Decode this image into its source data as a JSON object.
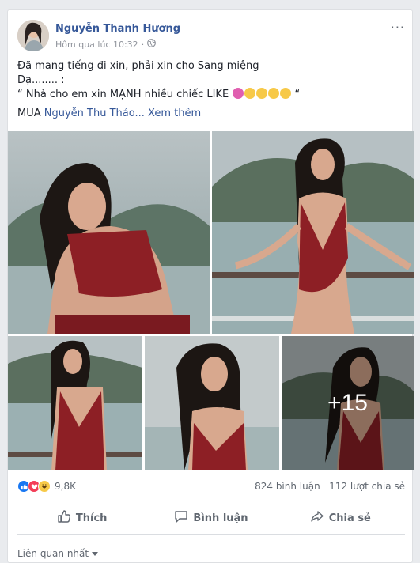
{
  "post": {
    "author": "Nguyễn Thanh Hương",
    "time": "Hôm qua lúc 10:32",
    "privacy_icon": "globe-icon",
    "more_label": "···",
    "lines": [
      "Đã mang tiếng đi xin, phải xin cho Sang miệng",
      "Dạ........ :",
      "“ Nhà cho em xin MẠNH nhiều chiếc LIKE"
    ],
    "quote_end": "“",
    "tag_prefix": "MUA",
    "tag_name": "Nguyễn Thu Thảo...",
    "see_more": "Xem thêm"
  },
  "photos": {
    "extra_count": "+15"
  },
  "stats": {
    "reactions_count": "9,8K",
    "comments": "824 bình luận",
    "shares": "112 lượt chia sẻ"
  },
  "actions": {
    "like": "Thích",
    "comment": "Bình luận",
    "share": "Chia sẻ"
  },
  "footer": {
    "sort_label": "Liên quan nhất"
  },
  "colors": {
    "link": "#365899",
    "like_blue": "#1877f2",
    "love_red": "#f33e58",
    "haha_yellow": "#f7c948"
  }
}
